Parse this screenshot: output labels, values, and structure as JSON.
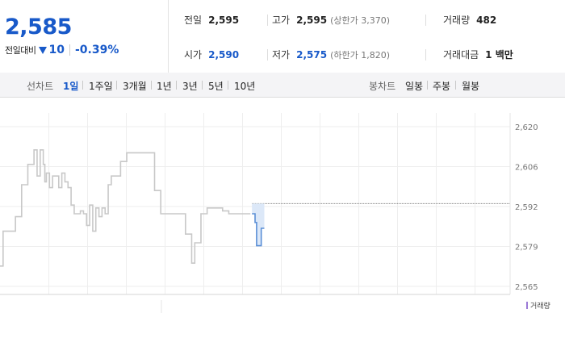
{
  "quote": {
    "price": "2,585",
    "change_label": "전일대비",
    "change_icon": "down-triangle-icon",
    "change_value": "10",
    "change_pct": "-0.39%",
    "prev_label": "전일",
    "prev_value": "2,595",
    "high_label": "고가",
    "high_value": "2,595",
    "upper_limit": "(상한가 3,370)",
    "volume_label": "거래량",
    "volume_value": "482",
    "open_label": "시가",
    "open_value": "2,590",
    "low_label": "저가",
    "low_value": "2,575",
    "lower_limit": "(하한가 1,820)",
    "amount_label": "거래대금",
    "amount_value": "1 백만"
  },
  "toolbar": {
    "line_label": "선차트",
    "line_periods": [
      "1일",
      "1주일",
      "3개월",
      "1년",
      "3년",
      "5년",
      "10년"
    ],
    "candle_label": "봉차트",
    "candle_periods": [
      "일봉",
      "주봉",
      "월봉"
    ]
  },
  "legend": {
    "volume": "거래량"
  },
  "colors": {
    "blue": "#1859c9",
    "gray_line": "#c8c8c8",
    "recent_line": "#5b8fd6",
    "volume_legend": "#9b7ad6"
  },
  "chart_data": {
    "type": "line",
    "ylim": [
      2565,
      2620
    ],
    "y_ticks": [
      "2,620",
      "2,606",
      "2,592",
      "2,579",
      "2,565"
    ],
    "reference_value": 2593.5,
    "series": [
      {
        "x": [
          0,
          1,
          2,
          4,
          6,
          8,
          10,
          12,
          14,
          16,
          18,
          20,
          22,
          24,
          26,
          28,
          29,
          30,
          32,
          34,
          36,
          38,
          40,
          42,
          44,
          46,
          48,
          50,
          52,
          54,
          56,
          58,
          60,
          62,
          64,
          66,
          68,
          70,
          72,
          74,
          76,
          78,
          80,
          82,
          84,
          86,
          88,
          90,
          92,
          94,
          96,
          98,
          100,
          102,
          104,
          106,
          108,
          110,
          112,
          114,
          116,
          118,
          120,
          122,
          124,
          126,
          128,
          130,
          132,
          134,
          136,
          138,
          140,
          142,
          144,
          146,
          148,
          150,
          152,
          154,
          156,
          158,
          160,
          162
        ],
        "y": [
          2572,
          2572,
          2584,
          2584,
          2584,
          2584,
          2589,
          2589,
          2600,
          2600,
          2607,
          2607,
          2612,
          2603,
          2612,
          2607,
          2601,
          2604,
          2599,
          2603,
          2603,
          2599,
          2604,
          2601,
          2599,
          2593,
          2590,
          2590,
          2591,
          2590,
          2586,
          2593,
          2584,
          2592,
          2589,
          2592,
          2590,
          2600,
          2603,
          2603,
          2603,
          2608,
          2608,
          2611,
          2611,
          2611,
          2611,
          2611,
          2611,
          2611,
          2611,
          2611,
          2598,
          2598,
          2590,
          2590,
          2590,
          2590,
          2590,
          2590,
          2590,
          2590,
          2583,
          2583,
          2573,
          2580,
          2580,
          2590,
          2590,
          2592,
          2592,
          2592,
          2592,
          2592,
          2591,
          2591,
          2590,
          2590,
          2590,
          2590,
          2590,
          2590,
          2590,
          2590
        ]
      },
      {
        "x": [
          163,
          164,
          165,
          166,
          167,
          168,
          169,
          170,
          171
        ],
        "y": [
          2590,
          2590,
          2587,
          2579,
          2579,
          2579,
          2585,
          2585,
          2585
        ]
      }
    ],
    "x_total": 330
  }
}
